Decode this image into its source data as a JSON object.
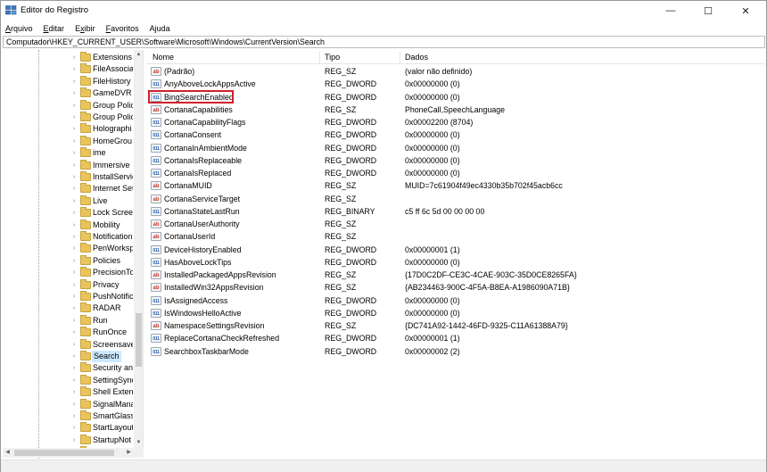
{
  "window": {
    "title": "Editor do Registro",
    "min": "—",
    "max": "☐",
    "close": "✕"
  },
  "menu": [
    "Arquivo",
    "Editar",
    "Exibir",
    "Favoritos",
    "Ajuda"
  ],
  "menu_mnemonic_index": [
    0,
    0,
    1,
    0,
    1
  ],
  "address": "Computador\\HKEY_CURRENT_USER\\Software\\Microsoft\\Windows\\CurrentVersion\\Search",
  "tree": {
    "items": [
      {
        "label": "Extensions"
      },
      {
        "label": "FileAssocia"
      },
      {
        "label": "FileHistory"
      },
      {
        "label": "GameDVR"
      },
      {
        "label": "Group Polic"
      },
      {
        "label": "Group Polic"
      },
      {
        "label": "Holographi"
      },
      {
        "label": "HomeGrou"
      },
      {
        "label": "ime"
      },
      {
        "label": "Immersive"
      },
      {
        "label": "InstallServic"
      },
      {
        "label": "Internet Set"
      },
      {
        "label": "Live"
      },
      {
        "label": "Lock Screen"
      },
      {
        "label": "Mobility"
      },
      {
        "label": "Notification"
      },
      {
        "label": "PenWorksp"
      },
      {
        "label": "Policies"
      },
      {
        "label": "PrecisionTo"
      },
      {
        "label": "Privacy"
      },
      {
        "label": "PushNotific"
      },
      {
        "label": "RADAR"
      },
      {
        "label": "Run"
      },
      {
        "label": "RunOnce"
      },
      {
        "label": "Screensave"
      },
      {
        "label": "Search",
        "selected": true
      },
      {
        "label": "Security an"
      },
      {
        "label": "SettingSync"
      },
      {
        "label": "Shell Exten"
      },
      {
        "label": "SignalMana"
      },
      {
        "label": "SmartGlass"
      },
      {
        "label": "StartLayout"
      },
      {
        "label": "StartupNot"
      },
      {
        "label": "StorageSen"
      }
    ]
  },
  "list": {
    "columns": {
      "name": "Nome",
      "type": "Tipo",
      "data": "Dados"
    },
    "rows": [
      {
        "icon": "string-value-icon",
        "name": "(Padrão)",
        "type": "REG_SZ",
        "data": "(valor não definido)"
      },
      {
        "icon": "dword-value-icon",
        "name": "AnyAboveLockAppsActive",
        "type": "REG_DWORD",
        "data": "0x00000000 (0)"
      },
      {
        "icon": "dword-value-icon",
        "name": "BingSearchEnabled",
        "type": "REG_DWORD",
        "data": "0x00000000 (0)",
        "highlighted": true
      },
      {
        "icon": "string-value-icon",
        "name": "CortanaCapabilities",
        "type": "REG_SZ",
        "data": "PhoneCall,SpeechLanguage"
      },
      {
        "icon": "dword-value-icon",
        "name": "CortanaCapabilityFlags",
        "type": "REG_DWORD",
        "data": "0x00002200 (8704)"
      },
      {
        "icon": "dword-value-icon",
        "name": "CortanaConsent",
        "type": "REG_DWORD",
        "data": "0x00000000 (0)"
      },
      {
        "icon": "dword-value-icon",
        "name": "CortanaInAmbientMode",
        "type": "REG_DWORD",
        "data": "0x00000000 (0)"
      },
      {
        "icon": "dword-value-icon",
        "name": "CortanaIsReplaceable",
        "type": "REG_DWORD",
        "data": "0x00000000 (0)"
      },
      {
        "icon": "dword-value-icon",
        "name": "CortanaIsReplaced",
        "type": "REG_DWORD",
        "data": "0x00000000 (0)"
      },
      {
        "icon": "string-value-icon",
        "name": "CortanaMUID",
        "type": "REG_SZ",
        "data": "MUID=7c61904f49ec4330b35b702f45acb6cc"
      },
      {
        "icon": "string-value-icon",
        "name": "CortanaServiceTarget",
        "type": "REG_SZ",
        "data": ""
      },
      {
        "icon": "dword-value-icon",
        "name": "CortanaStateLastRun",
        "type": "REG_BINARY",
        "data": "c5 ff 6c 5d 00 00 00 00"
      },
      {
        "icon": "string-value-icon",
        "name": "CortanaUserAuthority",
        "type": "REG_SZ",
        "data": ""
      },
      {
        "icon": "string-value-icon",
        "name": "CortanaUserId",
        "type": "REG_SZ",
        "data": ""
      },
      {
        "icon": "dword-value-icon",
        "name": "DeviceHistoryEnabled",
        "type": "REG_DWORD",
        "data": "0x00000001 (1)"
      },
      {
        "icon": "dword-value-icon",
        "name": "HasAboveLockTips",
        "type": "REG_DWORD",
        "data": "0x00000000 (0)"
      },
      {
        "icon": "string-value-icon",
        "name": "InstalledPackagedAppsRevision",
        "type": "REG_SZ",
        "data": "{17D0C2DF-CE3C-4CAE-903C-35D0CE8265FA}"
      },
      {
        "icon": "string-value-icon",
        "name": "InstalledWin32AppsRevision",
        "type": "REG_SZ",
        "data": "{AB234463-900C-4F5A-B8EA-A1986090A71B}"
      },
      {
        "icon": "dword-value-icon",
        "name": "IsAssignedAccess",
        "type": "REG_DWORD",
        "data": "0x00000000 (0)"
      },
      {
        "icon": "dword-value-icon",
        "name": "IsWindowsHelloActive",
        "type": "REG_DWORD",
        "data": "0x00000000 (0)"
      },
      {
        "icon": "string-value-icon",
        "name": "NamespaceSettingsRevision",
        "type": "REG_SZ",
        "data": "{DC741A92-1442-46FD-9325-C11A61388A79}"
      },
      {
        "icon": "dword-value-icon",
        "name": "ReplaceCortanaCheckRefreshed",
        "type": "REG_DWORD",
        "data": "0x00000001 (1)"
      },
      {
        "icon": "dword-value-icon",
        "name": "SearchboxTaskbarMode",
        "type": "REG_DWORD",
        "data": "0x00000002 (2)"
      }
    ]
  },
  "colors": {
    "highlight_box": "#d0202a",
    "selection": "#cce8ff",
    "folder": "#e8c45d"
  }
}
